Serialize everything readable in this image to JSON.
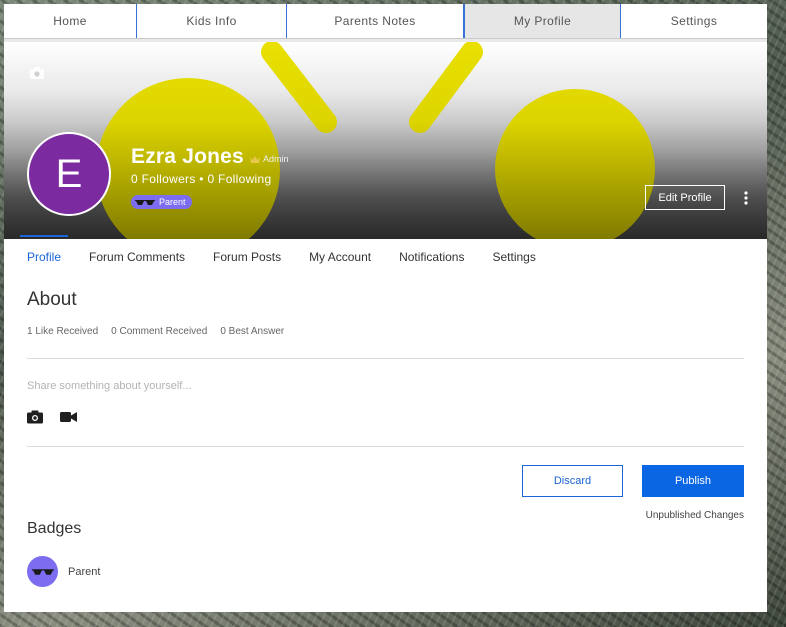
{
  "nav": {
    "items": [
      {
        "label": "Home"
      },
      {
        "label": "Kids Info"
      },
      {
        "label": "Parents Notes"
      },
      {
        "label": "My Profile"
      },
      {
        "label": "Settings"
      }
    ],
    "active_index": 3
  },
  "profile": {
    "initial": "E",
    "avatar_color": "#7b2aa0",
    "name": "Ezra Jones",
    "role": "Admin",
    "followers": "0 Followers",
    "separator": "•",
    "following": "0 Following",
    "badge_label": "Parent",
    "edit_label": "Edit Profile",
    "cover_accent": "#e9e000"
  },
  "tabs": [
    {
      "label": "Profile"
    },
    {
      "label": "Forum Comments"
    },
    {
      "label": "Forum Posts"
    },
    {
      "label": "My Account"
    },
    {
      "label": "Notifications"
    },
    {
      "label": "Settings"
    }
  ],
  "about": {
    "title": "About",
    "likes": "1 Like Received",
    "comments": "0 Comment Received",
    "best": "0 Best Answer",
    "placeholder": "Share something about yourself...",
    "discard_label": "Discard",
    "publish_label": "Publish",
    "status": "Unpublished Changes"
  },
  "badges": {
    "title": "Badges",
    "items": [
      {
        "label": "Parent",
        "color": "#7b6cf0"
      }
    ]
  },
  "colors": {
    "accent": "#1b63d6",
    "publish": "#0b66e4",
    "nav_divider": "#3a6fd8"
  }
}
